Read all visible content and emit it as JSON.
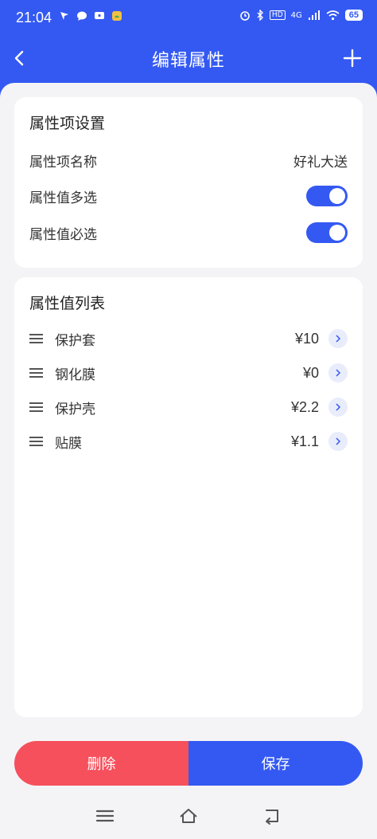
{
  "status_bar": {
    "time": "21:04",
    "network": "4G",
    "hd": "HD",
    "battery": "65"
  },
  "header": {
    "title": "编辑属性"
  },
  "settings": {
    "title": "属性项设置",
    "name_label": "属性项名称",
    "name_value": "好礼大送",
    "multi_label": "属性值多选",
    "multi_on": true,
    "required_label": "属性值必选",
    "required_on": true
  },
  "values": {
    "title": "属性值列表",
    "items": [
      {
        "name": "保护套",
        "price": "¥10"
      },
      {
        "name": "钢化膜",
        "price": "¥0"
      },
      {
        "name": "保护壳",
        "price": "¥2.2"
      },
      {
        "name": "贴膜",
        "price": "¥1.1"
      }
    ]
  },
  "actions": {
    "delete_label": "删除",
    "save_label": "保存"
  },
  "colors": {
    "primary": "#3459f2",
    "danger": "#f5505c",
    "background": "#f4f4f6"
  }
}
